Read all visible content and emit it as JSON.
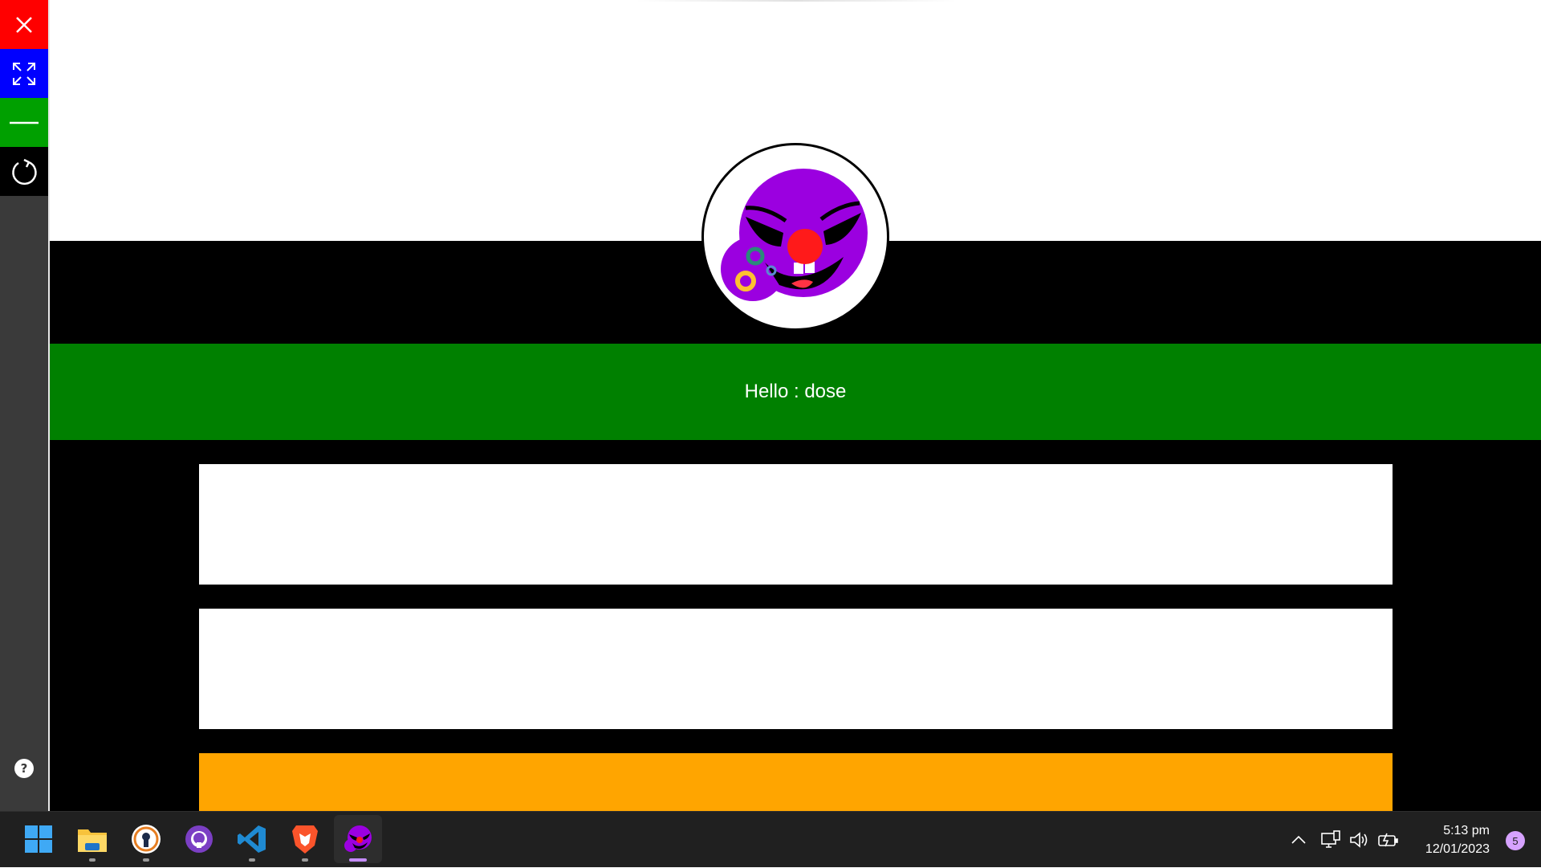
{
  "controls": {
    "close_icon": "close-icon",
    "maximize_icon": "expand-icon",
    "minimize_icon": "minimize-icon",
    "reload_icon": "reload-icon",
    "help_label": "?",
    "colors": {
      "close": "#ff0000",
      "maximize": "#0000ff",
      "minimize": "#00a000",
      "reload": "#000000"
    }
  },
  "header": {
    "avatar_icon": "purple-clown-logo-icon"
  },
  "greeting": {
    "text": "Hello : dose",
    "color": "#008000"
  },
  "form": {
    "field1_value": "",
    "field2_value": "",
    "button_label": "",
    "button_color": "#ffa500"
  },
  "taskbar": {
    "apps": [
      {
        "name": "start-icon"
      },
      {
        "name": "file-explorer-icon"
      },
      {
        "name": "keyhole-app-icon"
      },
      {
        "name": "github-icon"
      },
      {
        "name": "vscode-icon"
      },
      {
        "name": "brave-icon"
      },
      {
        "name": "clown-app-icon",
        "active": true
      }
    ],
    "tray_icons": [
      "chevron-up-icon",
      "network-icon",
      "volume-icon",
      "battery-icon"
    ],
    "time": "5:13 pm",
    "date": "12/01/2023",
    "notification_count": "5"
  }
}
